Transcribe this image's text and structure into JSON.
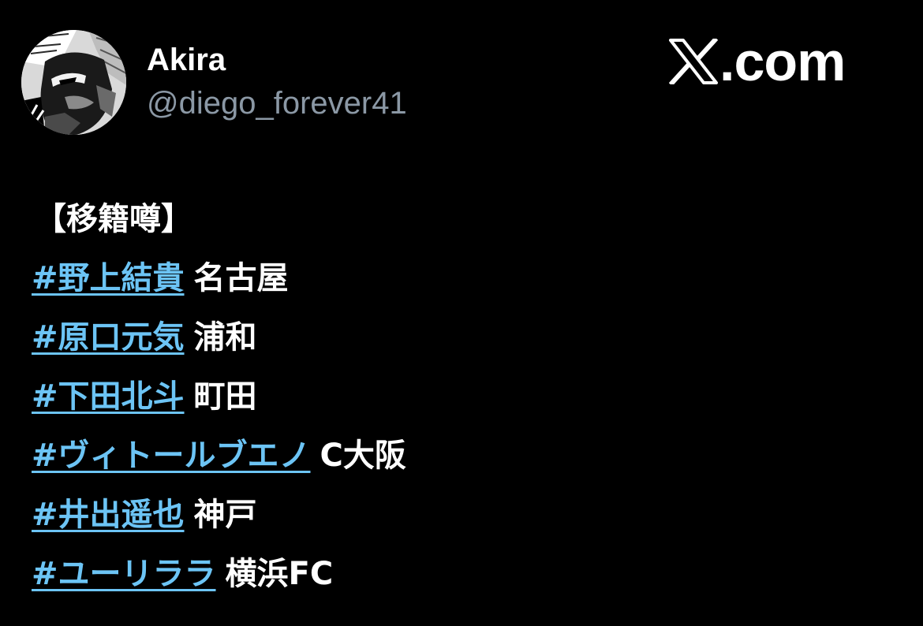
{
  "author": {
    "display_name": "Akira",
    "handle": "@diego_forever41",
    "avatar_icon": "manga-face-avatar"
  },
  "brand": {
    "logo_icon": "x-logo-icon",
    "domain": ".com"
  },
  "post": {
    "heading": "【移籍噂】",
    "entries": [
      {
        "hashtag": "#野上結貴",
        "team": "名古屋"
      },
      {
        "hashtag": "#原口元気",
        "team": "浦和"
      },
      {
        "hashtag": "#下田北斗",
        "team": "町田"
      },
      {
        "hashtag": "#ヴィトールブエノ",
        "team": "C大阪"
      },
      {
        "hashtag": "#井出遥也",
        "team": "神戸"
      },
      {
        "hashtag": "#ユーリララ",
        "team": "横浜FC"
      }
    ]
  },
  "colors": {
    "background": "#000000",
    "text": "#ffffff",
    "handle": "#8b98a5",
    "hashtag": "#6cc4f5"
  }
}
